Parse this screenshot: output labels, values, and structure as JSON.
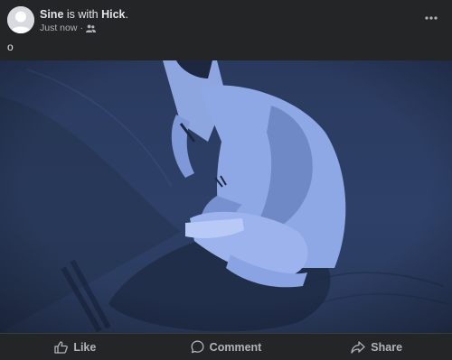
{
  "post": {
    "author": "Sine",
    "with_text": "is with",
    "tagged": "Hick",
    "punct": ".",
    "timestamp": "Just now",
    "separator": "·",
    "audience_icon": "friends-icon",
    "caption": "o",
    "more_icon": "more-dots-icon"
  },
  "actions": {
    "like": "Like",
    "comment": "Comment",
    "share": "Share"
  },
  "colors": {
    "background": "#242526",
    "text": "#e4e6eb",
    "muted": "#b0b3b8",
    "photo_tint": "#2c3d63"
  }
}
